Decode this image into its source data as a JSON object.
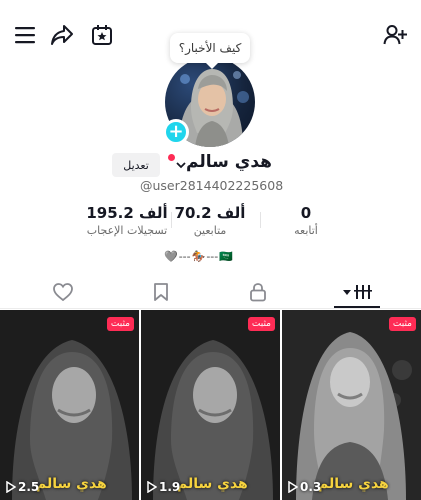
{
  "bubble_text": "كيف الأخبار؟",
  "profile": {
    "name": "هدي سالم",
    "handle": "@user2814402225608",
    "edit_label": "تعديل",
    "plus": "+"
  },
  "stats": {
    "likes": {
      "value": "195.2 ألف",
      "label": "تسجيلات الإعجاب"
    },
    "followers": {
      "value": "70.2 ألف",
      "label": "متابعين"
    },
    "following": {
      "value": "0",
      "label": "أتابعه"
    }
  },
  "bio": [
    "🇸🇦",
    "---",
    "🏇",
    "---",
    "🩶"
  ],
  "videos": [
    {
      "pinned_label": "مثبت",
      "caption": "هدي سالم",
      "views": "2.5"
    },
    {
      "pinned_label": "مثبت",
      "caption": "هدي سالم",
      "views": "1.9"
    },
    {
      "pinned_label": "مثبت",
      "caption": "هدي سالم",
      "views": "0.3"
    }
  ],
  "colors": {
    "accent_red": "#fe2c55",
    "plus_cyan": "#20d5ec",
    "caption_yellow": "#f6d33f"
  }
}
